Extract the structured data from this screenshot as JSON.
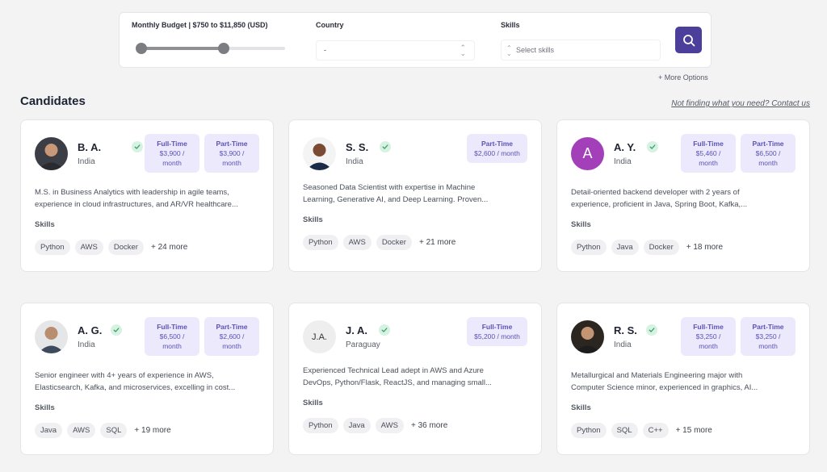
{
  "filters": {
    "budget_label": "Monthly Budget | $750 to $11,850 (USD)",
    "budget_low_fraction": 0.0,
    "budget_high_fraction": 0.58,
    "country_label": "Country",
    "country_value": "-",
    "skills_label": "Skills",
    "skills_placeholder": "Select skills"
  },
  "more_options": "+ More Options",
  "section_title": "Candidates",
  "contact_link": "Not finding what you need? Contact us",
  "skills_heading": "Skills",
  "candidates": [
    {
      "name": "B. A.",
      "country": "India",
      "avatar": "photo",
      "rates": [
        {
          "type": "Full-Time",
          "price": "$3,900 /",
          "unit": "month"
        },
        {
          "type": "Part-Time",
          "price": "$3,900 /",
          "unit": "month"
        }
      ],
      "desc_line1": "M.S. in Business Analytics with leadership in agile teams,",
      "desc_line2": "experience in cloud infrastructures, and AR/VR healthcare...",
      "skills": [
        "Python",
        "AWS",
        "Docker"
      ],
      "more": "+ 24 more"
    },
    {
      "name": "S. S.",
      "country": "India",
      "avatar": "photo",
      "rates": [
        {
          "type": "Part-Time",
          "price": "$2,600 / month"
        }
      ],
      "desc_line1": "Seasoned Data Scientist with expertise in Machine",
      "desc_line2": "Learning, Generative AI, and Deep Learning. Proven...",
      "skills": [
        "Python",
        "AWS",
        "Docker"
      ],
      "more": "+ 21 more"
    },
    {
      "name": "A. Y.",
      "country": "India",
      "avatar": "letter",
      "avatar_text": "A",
      "rates": [
        {
          "type": "Full-Time",
          "price": "$5,460 /",
          "unit": "month"
        },
        {
          "type": "Part-Time",
          "price": "$6,500 /",
          "unit": "month"
        }
      ],
      "desc_line1": "Detail-oriented backend developer with 2 years of",
      "desc_line2": "experience, proficient in Java, Spring Boot, Kafka,...",
      "skills": [
        "Python",
        "Java",
        "Docker"
      ],
      "more": "+ 18 more"
    },
    {
      "name": "A. G.",
      "country": "India",
      "avatar": "photo",
      "rates": [
        {
          "type": "Full-Time",
          "price": "$6,500 /",
          "unit": "month"
        },
        {
          "type": "Part-Time",
          "price": "$2,600 /",
          "unit": "month"
        }
      ],
      "desc_line1": "Senior engineer with 4+ years of experience in AWS,",
      "desc_line2": "Elasticsearch, Kafka, and microservices, excelling in cost...",
      "skills": [
        "Java",
        "AWS",
        "SQL"
      ],
      "more": "+ 19 more"
    },
    {
      "name": "J. A.",
      "country": "Paraguay",
      "avatar": "initials",
      "avatar_text": "J.A.",
      "rates": [
        {
          "type": "Full-Time",
          "price": "$5,200 / month"
        }
      ],
      "desc_line1": "Experienced Technical Lead adept in AWS and Azure",
      "desc_line2": "DevOps, Python/Flask, ReactJS, and managing small...",
      "skills": [
        "Python",
        "Java",
        "AWS"
      ],
      "more": "+ 36 more"
    },
    {
      "name": "R. S.",
      "country": "India",
      "avatar": "photo",
      "rates": [
        {
          "type": "Full-Time",
          "price": "$3,250 /",
          "unit": "month"
        },
        {
          "type": "Part-Time",
          "price": "$3,250 /",
          "unit": "month"
        }
      ],
      "desc_line1": "Metallurgical and Materials Engineering major with",
      "desc_line2": "Computer Science minor, experienced in graphics, AI...",
      "skills": [
        "Python",
        "SQL",
        "C++"
      ],
      "more": "+ 15 more"
    }
  ],
  "colors": {
    "accent": "#4b3f9b",
    "rate_bg": "#ebe9fb",
    "rate_text": "#5b53b5",
    "verified_bg": "#d6f2e2",
    "verified_check": "#3a9a62",
    "letter_avatar_bg": "#a33fb8"
  }
}
